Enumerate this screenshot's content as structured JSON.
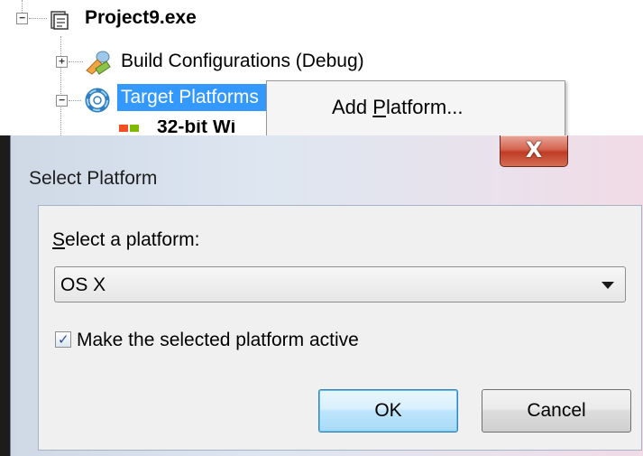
{
  "tree": {
    "project_label": "Project9.exe",
    "build_config_label": "Build Configurations (Debug)",
    "target_platforms_label": "Target Platforms",
    "partial_child_label": "32-bit Wi",
    "expand_minus": "−",
    "expand_plus": "+"
  },
  "context_menu": {
    "add_platform_prefix": "Add ",
    "add_platform_accel": "P",
    "add_platform_suffix": "latform..."
  },
  "dialog": {
    "title": "Select Platform",
    "close_glyph": "X",
    "select_label_accel": "S",
    "select_label_rest": "elect a platform:",
    "platform_value": "OS X",
    "checkbox_checked": true,
    "checkbox_mark": "✓",
    "checkbox_label": "Make the selected platform active",
    "ok_label": "OK",
    "cancel_label": "Cancel"
  },
  "colors": {
    "selection": "#3399ff",
    "close_button": "#c03c24",
    "ok_border": "#3c7fb1"
  }
}
